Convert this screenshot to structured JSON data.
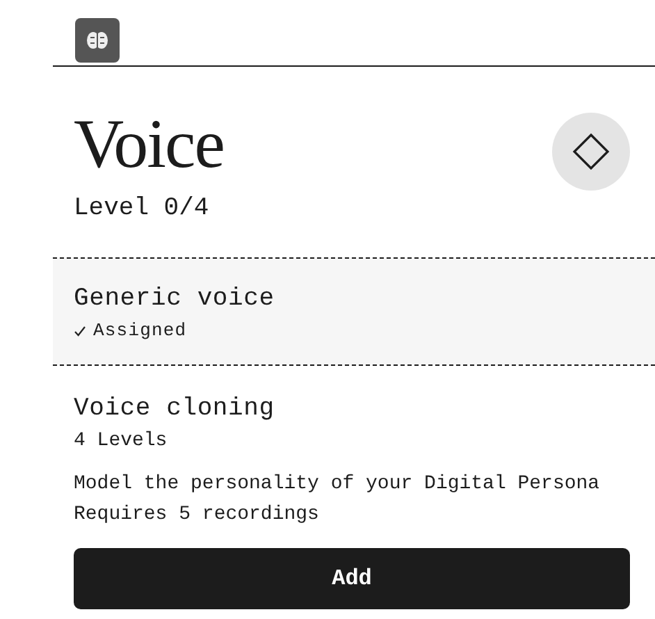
{
  "title": "Voice",
  "level_text": "Level 0/4",
  "options": [
    {
      "title": "Generic voice",
      "assigned": true,
      "status": "Assigned"
    },
    {
      "title": "Voice cloning",
      "assigned": false,
      "subtitle": "4 Levels",
      "lines": [
        "Model the personality of your Digital Persona",
        "Requires 5 recordings"
      ],
      "action": "Add"
    }
  ]
}
